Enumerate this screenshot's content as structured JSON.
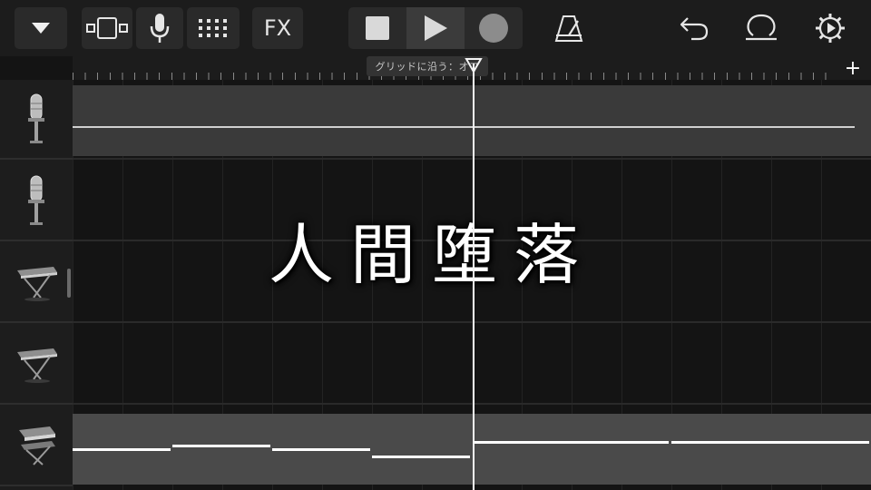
{
  "toolbar": {
    "fx_label": "FX",
    "icons": {
      "tracks": "down-triangle-icon",
      "view": "view-toggle-icon",
      "mic": "microphone-icon",
      "grid": "track-controls-icon",
      "metronome": "metronome-icon",
      "undo": "undo-icon",
      "loop": "loop-browser-icon",
      "settings": "settings-icon"
    }
  },
  "transport": {
    "stop": "stop-icon",
    "play": "play-icon",
    "record": "record-icon"
  },
  "ruler": {
    "grid_tooltip": "グリッドに沿う：オフ",
    "add_label": "+"
  },
  "tracks": [
    {
      "instrument": "microphone",
      "region": true
    },
    {
      "instrument": "microphone",
      "region": false
    },
    {
      "instrument": "keyboard",
      "region": false
    },
    {
      "instrument": "keyboard",
      "region": false
    },
    {
      "instrument": "keyboard",
      "region": true
    }
  ],
  "overlay_title": "人間堕落",
  "colors": {
    "background": "#141414",
    "region": "#4a4a4a",
    "playhead": "#f4f4f4"
  }
}
